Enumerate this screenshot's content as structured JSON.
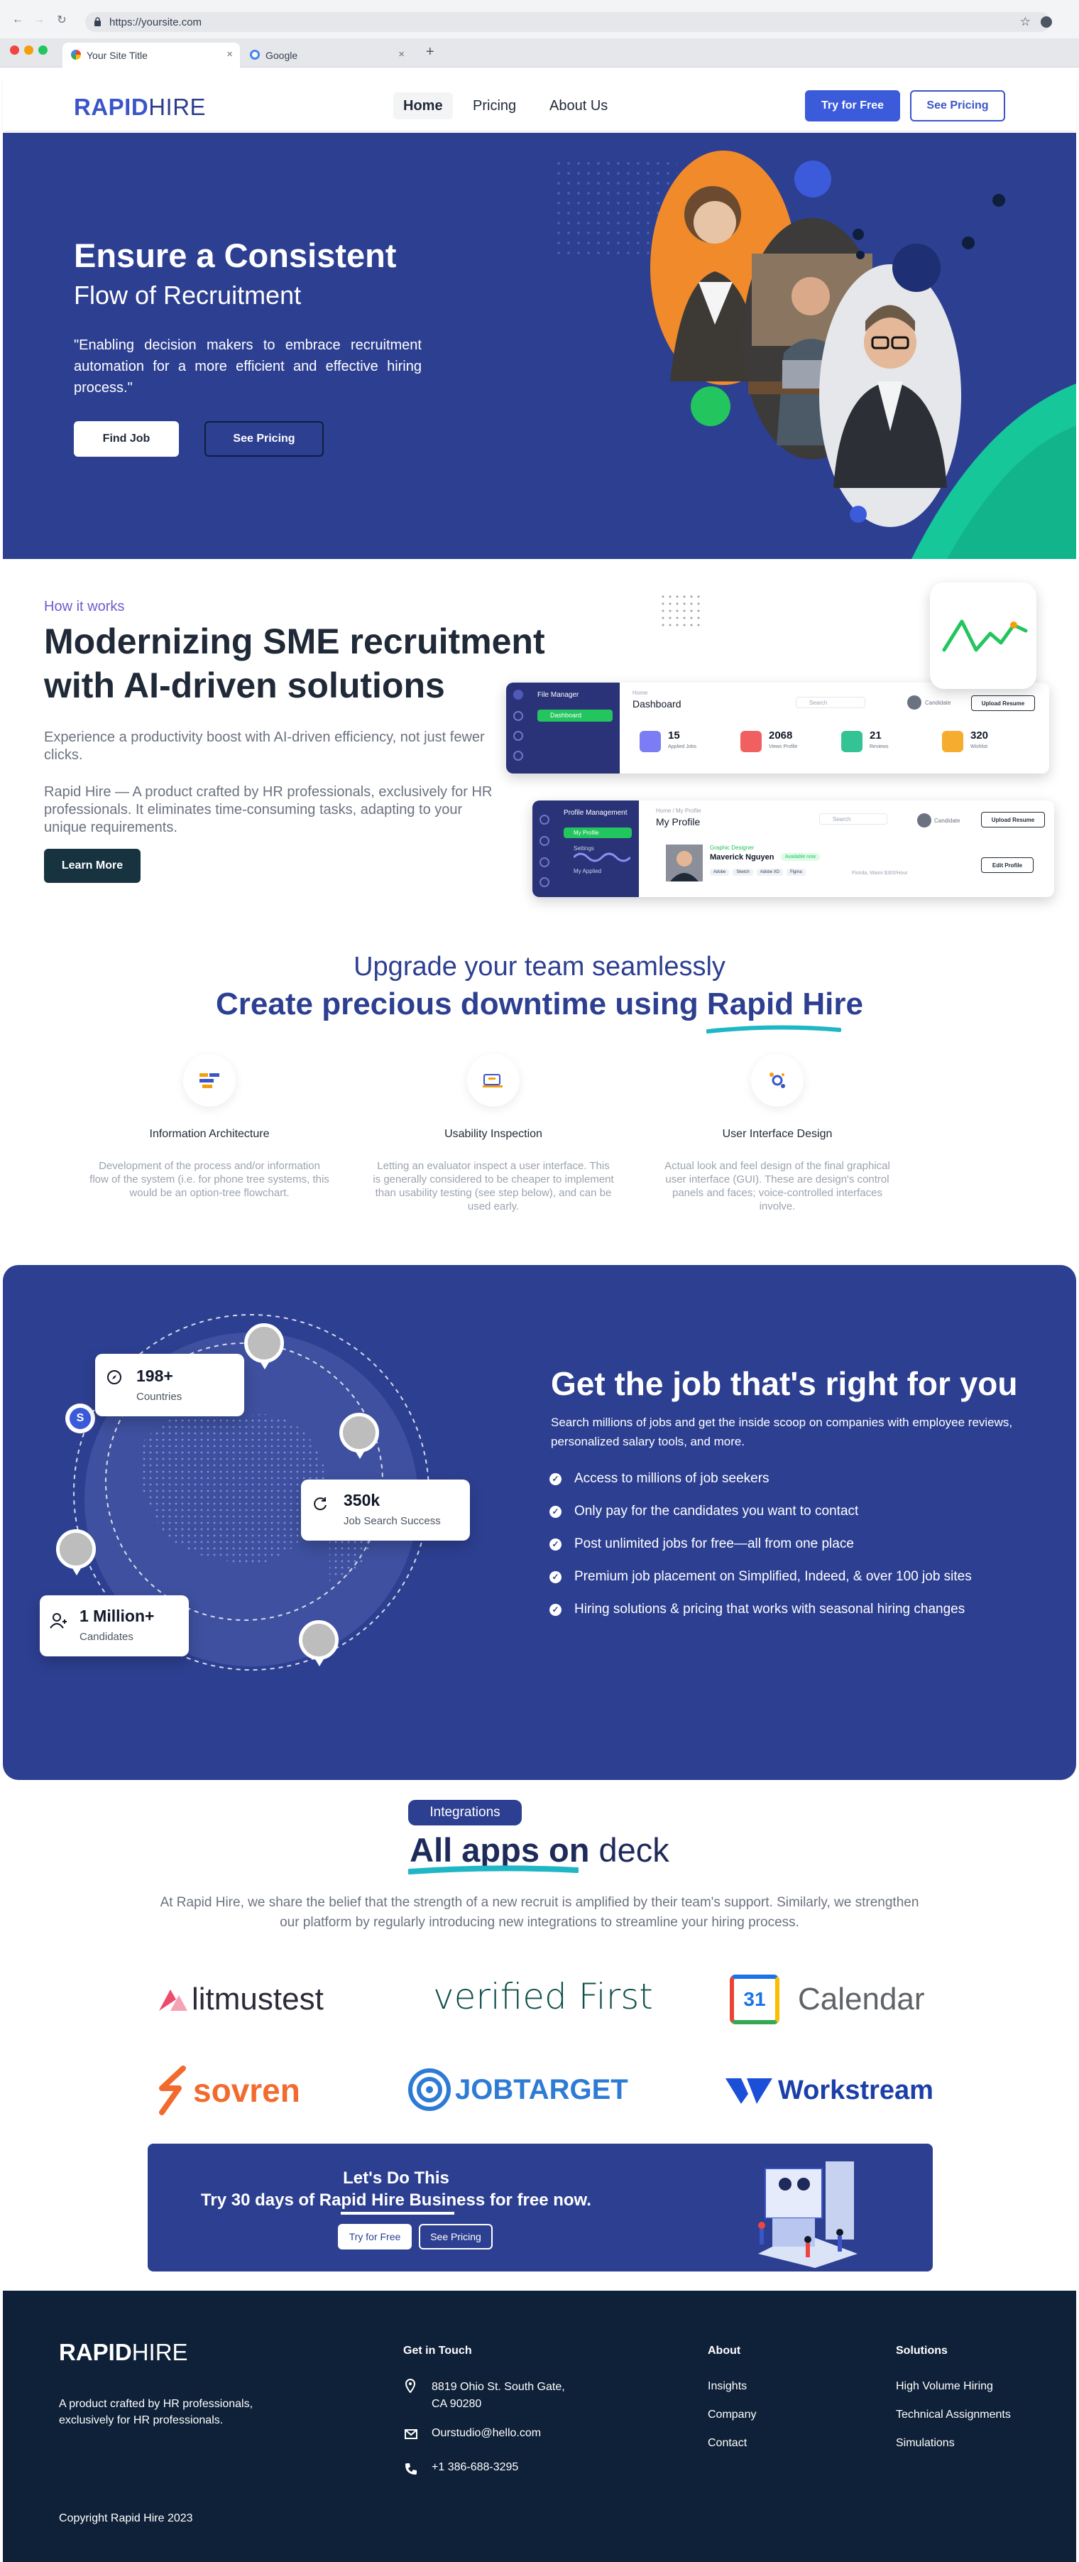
{
  "browser": {
    "url": "https://yoursite.com",
    "tabs": [
      {
        "title": "Your Site Title"
      },
      {
        "title": "Google"
      }
    ]
  },
  "header": {
    "logo_bold": "RAPID",
    "logo_light": "HIRE",
    "nav": [
      "Home",
      "Pricing",
      "About Us"
    ],
    "try_free": "Try for Free",
    "see_pricing": "See Pricing"
  },
  "hero": {
    "title_line1": "Ensure a Consistent",
    "title_line2": "Flow of Recruitment",
    "quote": "\"Enabling decision makers to embrace recruitment automation for a more efficient and effective hiring process.\"",
    "find_job": "Find Job",
    "see_pricing": "See Pricing"
  },
  "how": {
    "label": "How it works",
    "title_line1": "Modernizing SME recruitment",
    "title_line2": "with AI-driven solutions",
    "para1": "Experience a productivity boost with AI-driven efficiency, not just fewer clicks.",
    "para2": "Rapid Hire — A product crafted by HR professionals, exclusively for HR professionals. It eliminates time-consuming tasks, adapting to your unique requirements.",
    "learn_more": "Learn More",
    "dashboard": {
      "sidebar_title": "File Manager",
      "sidebar_item": "Dashboard",
      "crumb": "Home",
      "title": "Dashboard",
      "search": "Search",
      "user": "Candidate",
      "upload": "Upload Resume",
      "stats": [
        {
          "n": "15",
          "l": "Applied Jobs",
          "color": "#6366f1"
        },
        {
          "n": "2068",
          "l": "Views Profile",
          "color": "#ef4444"
        },
        {
          "n": "21",
          "l": "Reviews",
          "color": "#10b981"
        },
        {
          "n": "320",
          "l": "Wishlist",
          "color": "#f59e0b"
        }
      ]
    },
    "profile": {
      "sidebar_title": "Profile Management",
      "sidebar_items": [
        "My Profile",
        "Settings",
        "My Applied"
      ],
      "crumb": "Home / My Profile",
      "title": "My Profile",
      "search": "Search",
      "user": "Candidate",
      "upload": "Upload Resume",
      "role": "Graphic Designer",
      "name": "Maverick Nguyen",
      "status": "Available now",
      "tags": [
        "Adobe",
        "Sketch",
        "Adobe XD",
        "Figma"
      ],
      "meta": "Florida, Miami   $300/Hour",
      "edit": "Edit Profile"
    }
  },
  "upgrade": {
    "line1": "Upgrade your team seamlessly",
    "line2_a": "Create precious downtime using ",
    "line2_b": "Rapid Hire",
    "features": [
      {
        "icon": "architecture-icon",
        "title": "Information Architecture",
        "desc": "Development of the process and/or information flow of the system (i.e. for phone tree systems, this would be an option-tree flowchart."
      },
      {
        "icon": "usability-icon",
        "title": "Usability Inspection",
        "desc": "Letting an evaluator inspect a user interface. This is generally considered to be cheaper to implement than usability testing (see step below), and can be used early."
      },
      {
        "icon": "ui-design-icon",
        "title": "User Interface Design",
        "desc": "Actual look and feel design of the final graphical user interface (GUI). These are design's control panels and faces; voice-controlled interfaces involve."
      }
    ]
  },
  "jobs": {
    "title": "Get the job that's right for you",
    "subtitle": "Search millions of jobs and get the inside scoop on companies with employee reviews, personalized salary tools, and more.",
    "bullets": [
      "Access to millions of job seekers",
      "Only pay for the candidates you want to contact",
      "Post unlimited jobs for free—all from one place",
      "Premium job placement on Simplified, Indeed, & over 100 job sites",
      "Hiring solutions & pricing that works with seasonal hiring changes"
    ],
    "stats": [
      {
        "n": "198+",
        "l": "Countries"
      },
      {
        "n": "350k",
        "l": "Job Search Success"
      },
      {
        "n": "1 Million+",
        "l": "Candidates"
      }
    ]
  },
  "integrations": {
    "badge": "Integrations",
    "title_a": "All apps on",
    "title_b": " deck",
    "desc": "At Rapid Hire, we share the belief that the strength of a new recruit is amplified by their team's support. Similarly, we strengthen our platform by regularly introducing new integrations to streamline your hiring process.",
    "logos": [
      "litmustest",
      "verified First",
      "Calendar",
      "sovren",
      "JOBTARGET",
      "Workstream"
    ],
    "calendar_day": "31"
  },
  "cta": {
    "line1": "Let's Do This",
    "line2": "Try 30 days of Rapid Hire Business for free now.",
    "try_free": "Try for Free",
    "see_pricing": "See Pricing"
  },
  "footer": {
    "logo_bold": "RAPID",
    "logo_light": "HIRE",
    "tagline": "A product crafted by HR professionals, exclusively for HR professionals.",
    "contact_title": "Get in Touch",
    "address": "8819 Ohio St. South Gate, CA 90280",
    "email": "Ourstudio@hello.com",
    "phone": "+1 386-688-3295",
    "about_title": "About",
    "about_links": [
      "Insights",
      "Company",
      "Contact"
    ],
    "solutions_title": "Solutions",
    "solutions_links": [
      "High Volume Hiring",
      "Technical Assignments",
      "Simulations"
    ],
    "copyright": "Copyright Rapid Hire 2023"
  },
  "colors": {
    "primary": "#2d3f91",
    "accent": "#3b55c9",
    "green": "#16c79a",
    "footer": "#0f2138"
  }
}
